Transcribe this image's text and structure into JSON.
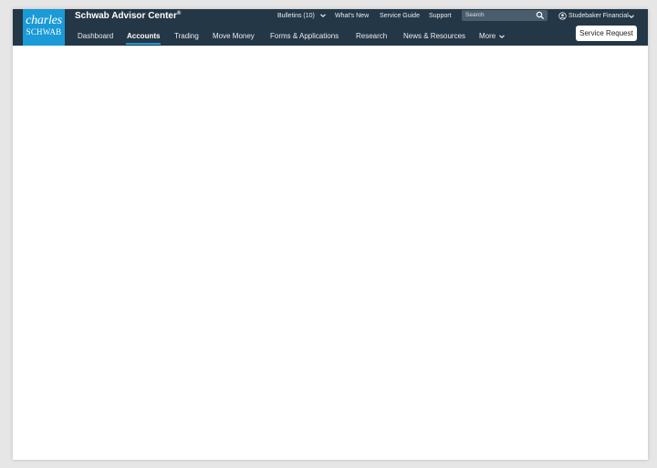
{
  "brand": {
    "logo_line1": "charles",
    "logo_line2": "SCHWAB",
    "app_title": "Schwab Advisor Center",
    "registered_mark": "®"
  },
  "utility_nav": {
    "bulletins": "Bulletins (10)",
    "whats_new": "What's New",
    "service_guide": "Service Guide",
    "support": "Support"
  },
  "search": {
    "placeholder": "Search",
    "icon": "search-icon"
  },
  "user": {
    "name": "Studebaker Financial",
    "icon": "user-circle-icon"
  },
  "main_nav": {
    "items": [
      {
        "label": "Dashboard"
      },
      {
        "label": "Accounts",
        "active": true
      },
      {
        "label": "Trading"
      },
      {
        "label": "Move Money"
      },
      {
        "label": "Forms & Applications"
      },
      {
        "label": "Research"
      },
      {
        "label": "News & Resources"
      },
      {
        "label": "More"
      }
    ]
  },
  "service_request": "Service Request",
  "colors": {
    "header_bg": "#243746",
    "brand_blue": "#1a9ad6",
    "page_bg": "#e6e6e6",
    "content_bg": "#ffffff"
  }
}
